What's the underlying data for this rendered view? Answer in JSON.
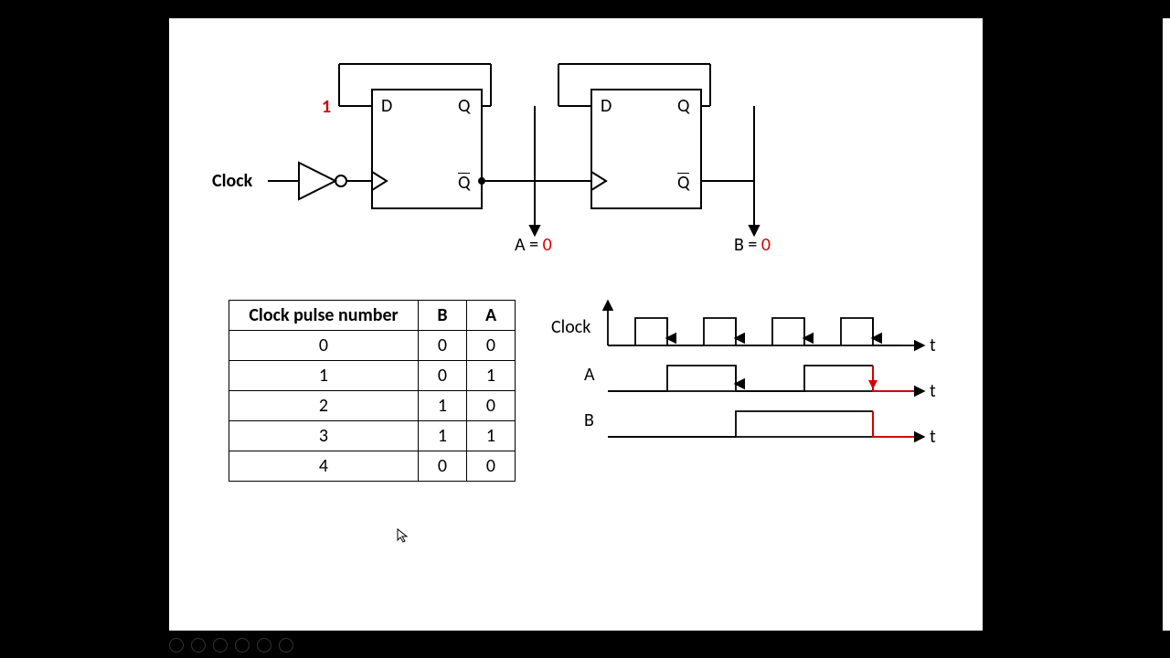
{
  "circuit": {
    "clock_label": "Clock",
    "d_input_value": "1",
    "ff1": {
      "D": "D",
      "Q": "Q",
      "Qbar": "Q"
    },
    "ff2": {
      "D": "D",
      "Q": "Q",
      "Qbar": "Q"
    },
    "outputA": {
      "name": "A",
      "eq": " = ",
      "value": "0"
    },
    "outputB": {
      "name": "B",
      "eq": " = ",
      "value": "0"
    }
  },
  "truth_table": {
    "headers": {
      "col1": "Clock pulse number",
      "col2": "B",
      "col3": "A"
    },
    "rows": [
      {
        "n": "0",
        "B": "0",
        "A": "0"
      },
      {
        "n": "1",
        "B": "0",
        "A": "1"
      },
      {
        "n": "2",
        "B": "1",
        "A": "0"
      },
      {
        "n": "3",
        "B": "1",
        "A": "1"
      },
      {
        "n": "4",
        "B": "0",
        "A": "0"
      }
    ]
  },
  "timing": {
    "signals": {
      "clock": "Clock",
      "A": "A",
      "B": "B"
    },
    "axis": "t"
  },
  "chart_data": {
    "type": "table",
    "title": "2-bit ripple counter (D flip-flops, falling-edge clock via inverter): truth table and timing diagram",
    "columns": [
      "Clock pulse number",
      "B",
      "A"
    ],
    "rows": [
      [
        0,
        0,
        0
      ],
      [
        1,
        0,
        1
      ],
      [
        2,
        1,
        0
      ],
      [
        3,
        1,
        1
      ],
      [
        4,
        0,
        0
      ]
    ],
    "timing": {
      "clock_edges_falling": [
        1,
        2,
        3,
        4
      ],
      "A_sequence": [
        0,
        1,
        0,
        1,
        0
      ],
      "B_sequence": [
        0,
        0,
        1,
        1,
        0
      ]
    }
  }
}
